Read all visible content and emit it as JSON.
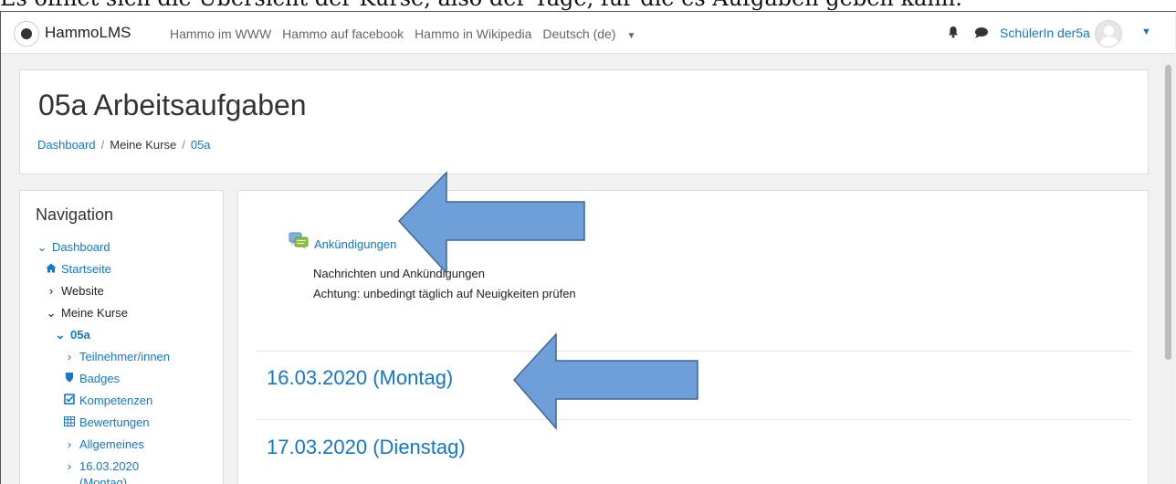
{
  "caption": "Es öffnet sich die Übersicht der Kurse, also der Tage, für die es Aufgaben geben kann.",
  "navbar": {
    "brand": "HammoLMS",
    "links": [
      "Hammo im WWW",
      "Hammo auf facebook",
      "Hammo in Wikipedia"
    ],
    "language": "Deutsch (de)",
    "user": "SchülerIn der5a"
  },
  "header": {
    "title": "05a Arbeitsaufgaben",
    "breadcrumb": [
      "Dashboard",
      "Meine Kurse",
      "05a"
    ]
  },
  "navigation": {
    "title": "Navigation",
    "items": [
      {
        "label": "Dashboard",
        "icon": "chevron-down-icon"
      },
      {
        "label": "Startseite",
        "icon": "home-icon"
      },
      {
        "label": "Website",
        "icon": "chevron-right-icon"
      },
      {
        "label": "Meine Kurse",
        "icon": "chevron-down-icon"
      },
      {
        "label": "05a",
        "icon": "chevron-down-icon"
      },
      {
        "label": "Teilnehmer/innen",
        "icon": "chevron-right-icon"
      },
      {
        "label": "Badges",
        "icon": "shield-icon"
      },
      {
        "label": "Kompetenzen",
        "icon": "checkbox-icon"
      },
      {
        "label": "Bewertungen",
        "icon": "table-icon"
      },
      {
        "label": "Allgemeines",
        "icon": "chevron-right-icon"
      },
      {
        "label": "16.03.2020",
        "icon": "chevron-right-icon"
      },
      {
        "label": "(Montag)",
        "icon": ""
      }
    ]
  },
  "main": {
    "announcement": {
      "link": "Ankündigungen",
      "description1": "Nachrichten und Ankündigungen",
      "description2": "Achtung: unbedingt täglich auf Neuigkeiten prüfen"
    },
    "sections": [
      "16.03.2020 (Montag)",
      "17.03.2020 (Dienstag)"
    ]
  },
  "colors": {
    "link": "#1177d1",
    "arrow_fill": "#6f9fd8",
    "arrow_stroke": "#3d6699"
  }
}
